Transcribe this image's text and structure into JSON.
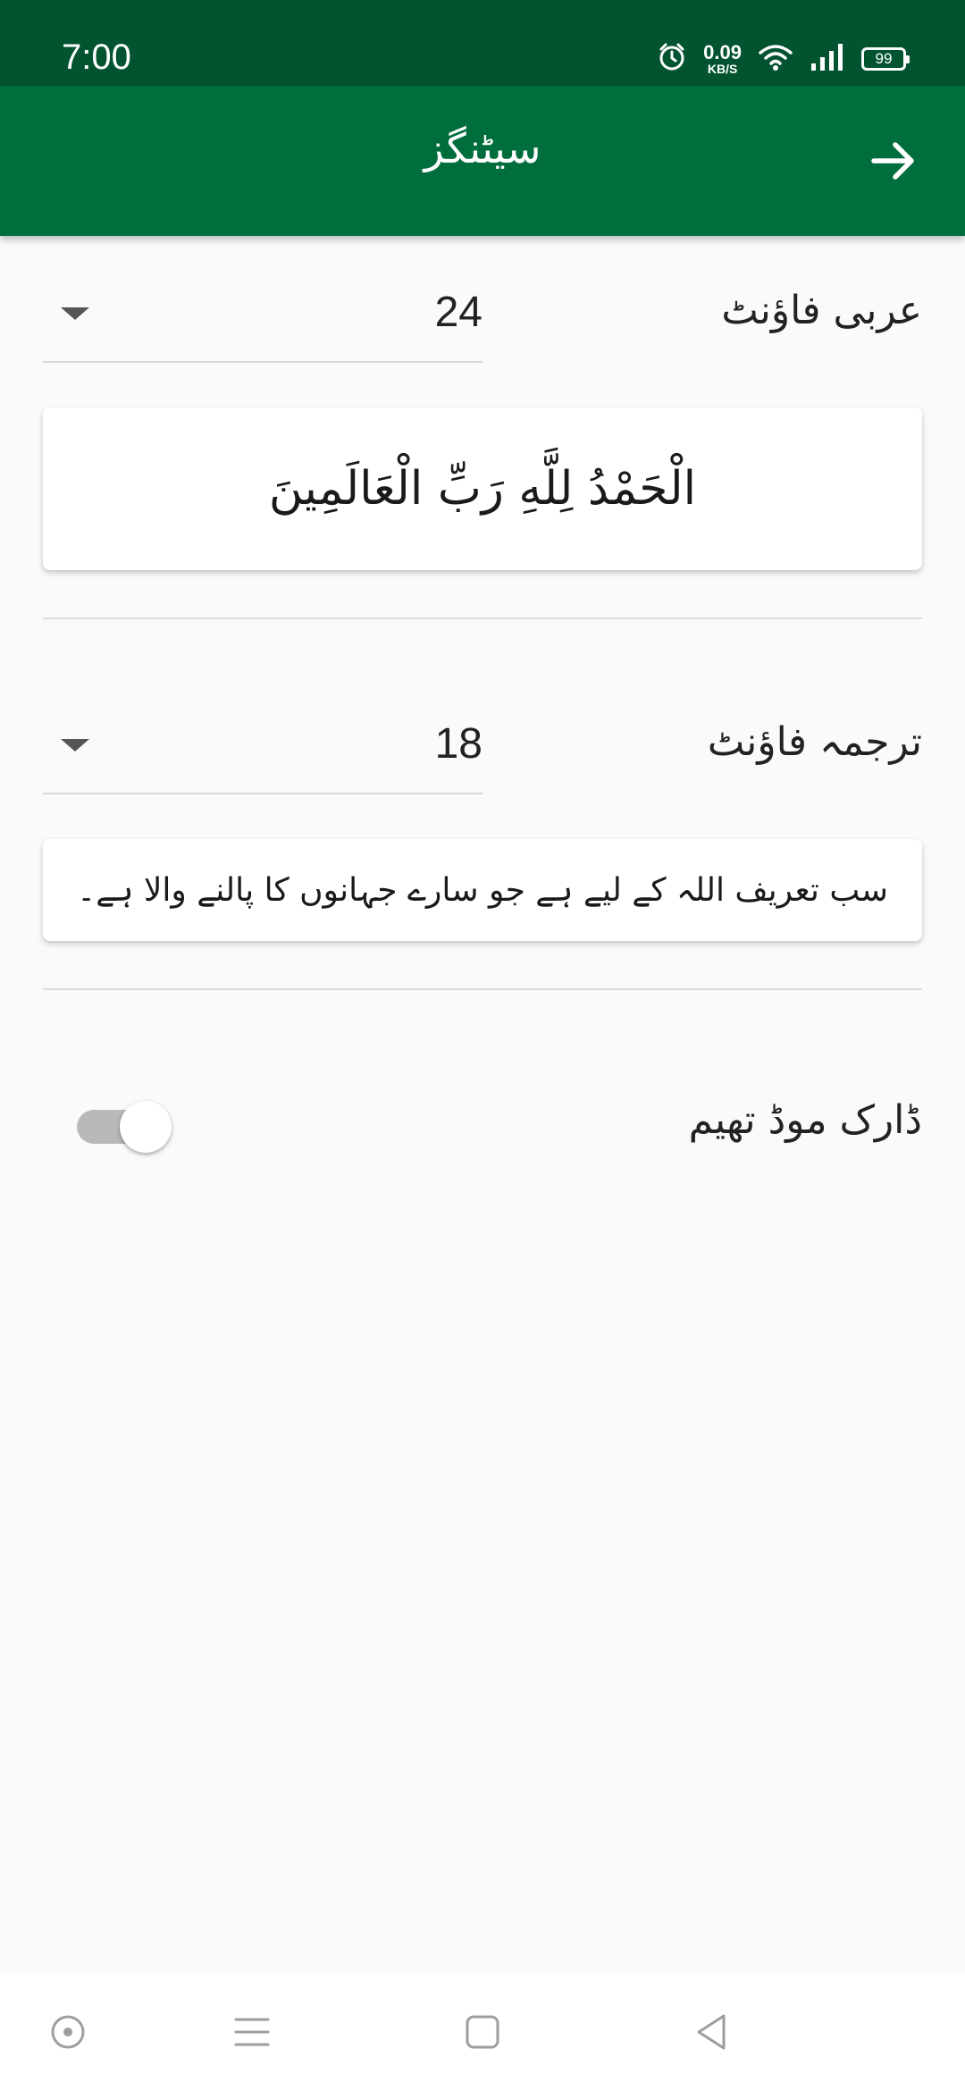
{
  "status_bar": {
    "time": "7:00",
    "net_speed": "0.09",
    "net_speed_unit": "KB/S",
    "battery": "99",
    "icons": [
      "alarm-icon",
      "wifi-icon",
      "signal-icon",
      "battery-icon"
    ]
  },
  "app_bar": {
    "title": "سیٹنگز",
    "forward_icon": "arrow-right-icon"
  },
  "settings": {
    "arabic_font": {
      "label": "عربی فاؤنٹ",
      "value": "24",
      "preview": "الْحَمْدُ لِلَّهِ رَبِّ الْعَالَمِينَ"
    },
    "translation_font": {
      "label": "ترجمہ فاؤنٹ",
      "value": "18",
      "preview": "سب تعریف اللہ کے لیے ہے جو سارے جہانوں کا پالنے والا ہے۔"
    },
    "dark_mode": {
      "label": "ڈارک موڈ تھیم",
      "enabled": false
    }
  },
  "nav_bar": {
    "icons": [
      "assistant-icon",
      "menu-icon",
      "home-icon",
      "back-icon"
    ]
  },
  "colors": {
    "status_bar": "#025430",
    "app_bar": "#006d3d",
    "background": "#fafafa",
    "toggle_off": "#b9b9b9"
  }
}
